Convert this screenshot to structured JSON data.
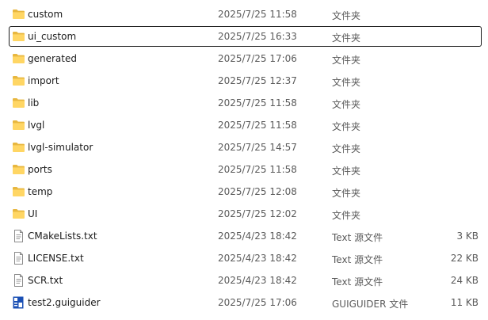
{
  "files": [
    {
      "name": "custom",
      "date": "2025/7/25 11:58",
      "type": "文件夹",
      "size": "",
      "icon": "folder-icon",
      "selected": false
    },
    {
      "name": "ui_custom",
      "date": "2025/7/25 16:33",
      "type": "文件夹",
      "size": "",
      "icon": "folder-icon",
      "selected": true
    },
    {
      "name": "generated",
      "date": "2025/7/25 17:06",
      "type": "文件夹",
      "size": "",
      "icon": "folder-icon",
      "selected": false
    },
    {
      "name": "import",
      "date": "2025/7/25 12:37",
      "type": "文件夹",
      "size": "",
      "icon": "folder-icon",
      "selected": false
    },
    {
      "name": "lib",
      "date": "2025/7/25 11:58",
      "type": "文件夹",
      "size": "",
      "icon": "folder-icon",
      "selected": false
    },
    {
      "name": "lvgl",
      "date": "2025/7/25 11:58",
      "type": "文件夹",
      "size": "",
      "icon": "folder-icon",
      "selected": false
    },
    {
      "name": "lvgl-simulator",
      "date": "2025/7/25 14:57",
      "type": "文件夹",
      "size": "",
      "icon": "folder-icon",
      "selected": false
    },
    {
      "name": "ports",
      "date": "2025/7/25 11:58",
      "type": "文件夹",
      "size": "",
      "icon": "folder-icon",
      "selected": false
    },
    {
      "name": "temp",
      "date": "2025/7/25 12:08",
      "type": "文件夹",
      "size": "",
      "icon": "folder-icon",
      "selected": false
    },
    {
      "name": "UI",
      "date": "2025/7/25 12:02",
      "type": "文件夹",
      "size": "",
      "icon": "folder-icon",
      "selected": false
    },
    {
      "name": "CMakeLists.txt",
      "date": "2025/4/23 18:42",
      "type": "Text 源文件",
      "size": "3 KB",
      "icon": "text-file-icon",
      "selected": false
    },
    {
      "name": "LICENSE.txt",
      "date": "2025/4/23 18:42",
      "type": "Text 源文件",
      "size": "22 KB",
      "icon": "text-file-icon",
      "selected": false
    },
    {
      "name": "SCR.txt",
      "date": "2025/4/23 18:42",
      "type": "Text 源文件",
      "size": "24 KB",
      "icon": "text-file-icon",
      "selected": false
    },
    {
      "name": "test2.guiguider",
      "date": "2025/7/25 17:06",
      "type": "GUIGUIDER 文件",
      "size": "11 KB",
      "icon": "guiguider-file-icon",
      "selected": false
    }
  ],
  "colors": {
    "folder_back": "#e8b73f",
    "folder_front": "#ffd664",
    "text_secondary": "#5a5a5a",
    "selection_border": "#1b1b1b",
    "guiguider_blue": "#1a4fb4"
  }
}
